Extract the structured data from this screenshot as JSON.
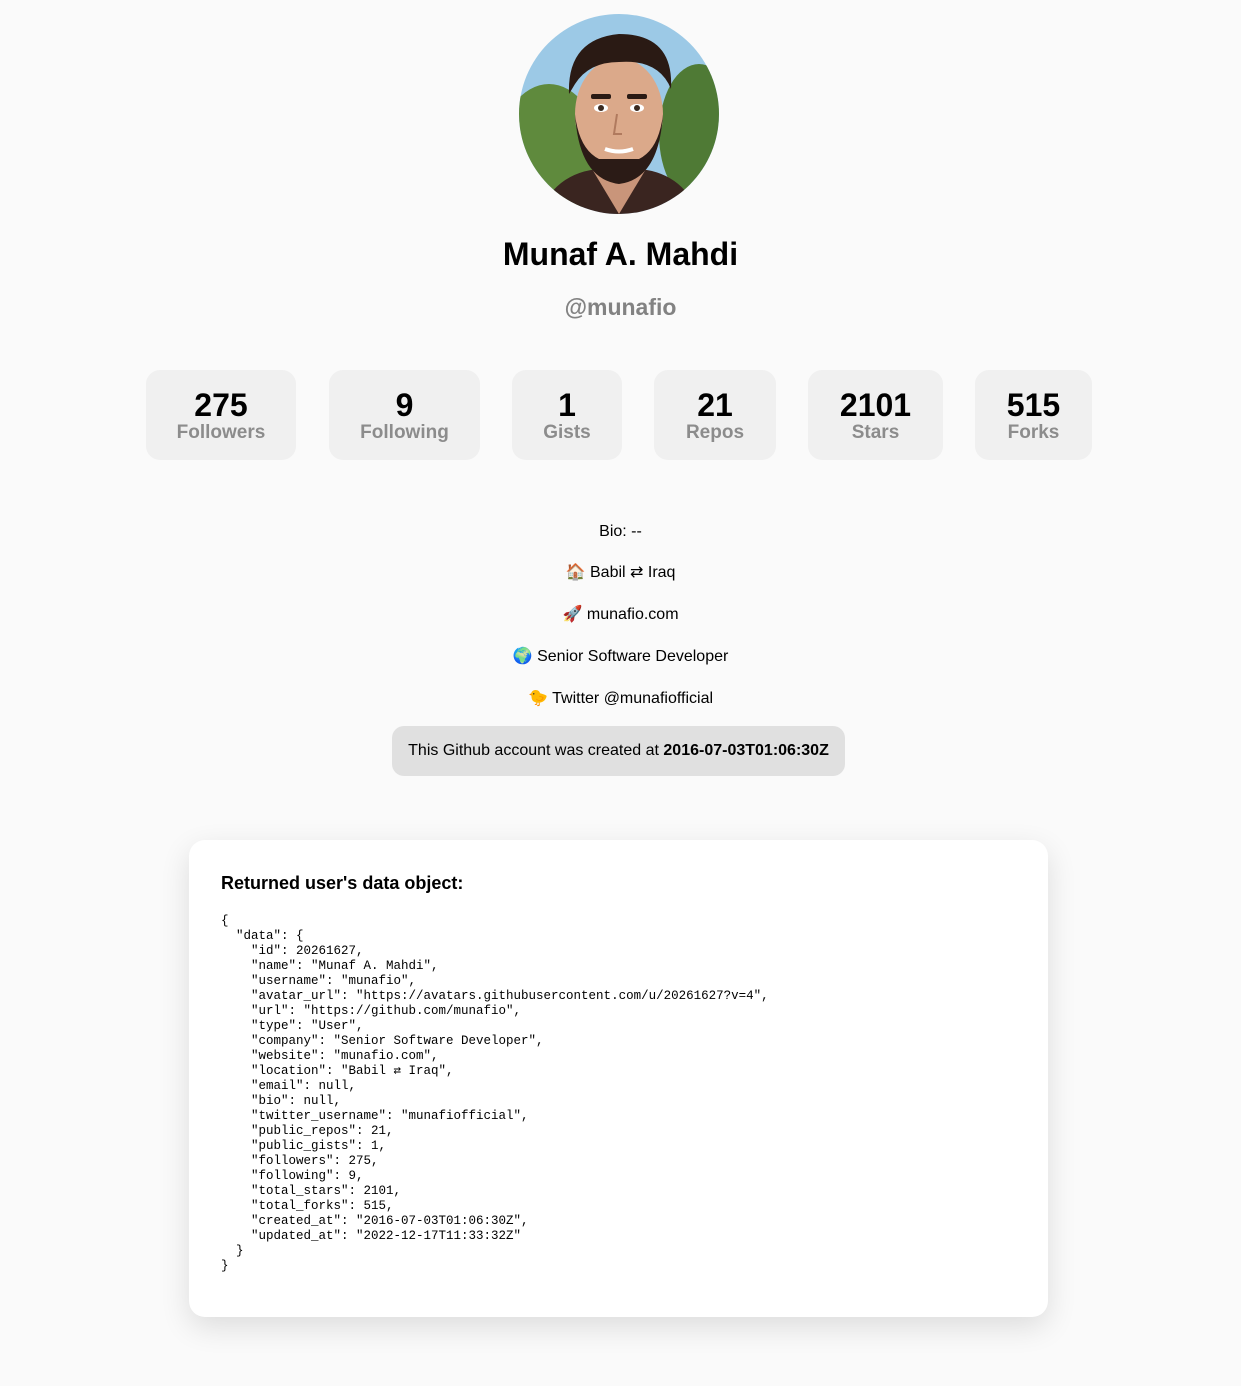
{
  "profile": {
    "name": "Munaf A. Mahdi",
    "username": "@munafio",
    "avatar_icon": "avatar-portrait"
  },
  "stats": [
    {
      "value": "275",
      "label": "Followers"
    },
    {
      "value": "9",
      "label": "Following"
    },
    {
      "value": "1",
      "label": "Gists"
    },
    {
      "value": "21",
      "label": "Repos"
    },
    {
      "value": "2101",
      "label": "Stars"
    },
    {
      "value": "515",
      "label": "Forks"
    }
  ],
  "info": {
    "bio": "Bio: --",
    "location_emoji": "🏠",
    "location": "Babil ⇄ Iraq",
    "website_emoji": "🚀",
    "website": "munafio.com",
    "company_emoji": "🌍",
    "company": "Senior Software Developer",
    "twitter_emoji": "🐤",
    "twitter": "Twitter @munafiofficial"
  },
  "created": {
    "prefix": "This Github account was created at ",
    "timestamp": "2016-07-03T01:06:30Z"
  },
  "data_card": {
    "title": "Returned user's data object:",
    "json_text": "{\n  \"data\": {\n    \"id\": 20261627,\n    \"name\": \"Munaf A. Mahdi\",\n    \"username\": \"munafio\",\n    \"avatar_url\": \"https://avatars.githubusercontent.com/u/20261627?v=4\",\n    \"url\": \"https://github.com/munafio\",\n    \"type\": \"User\",\n    \"company\": \"Senior Software Developer\",\n    \"website\": \"munafio.com\",\n    \"location\": \"Babil ⇄ Iraq\",\n    \"email\": null,\n    \"bio\": null,\n    \"twitter_username\": \"munafiofficial\",\n    \"public_repos\": 21,\n    \"public_gists\": 1,\n    \"followers\": 275,\n    \"following\": 9,\n    \"total_stars\": 2101,\n    \"total_forks\": 515,\n    \"created_at\": \"2016-07-03T01:06:30Z\",\n    \"updated_at\": \"2022-12-17T11:33:32Z\"\n  }\n}"
  },
  "colors": {
    "background": "#fafafa",
    "stat_box": "#f0f0f0",
    "muted_text": "#828282",
    "created_box": "#e0e0e0"
  }
}
